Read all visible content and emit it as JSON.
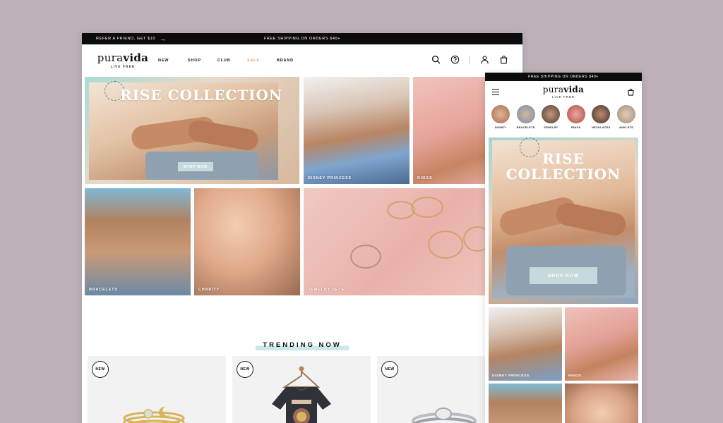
{
  "desktop": {
    "topbar": {
      "refer": "REFER A FRIEND, GET $10",
      "shipping": "FREE SHIPPING ON ORDERS $40+"
    },
    "logo": {
      "word_a": "pura",
      "word_b": "vida",
      "tagline": "LIVE FREE"
    },
    "menu": [
      "NEW",
      "SHOP",
      "CLUB",
      "SALE",
      "BRAND"
    ],
    "hero": {
      "title": "RISE COLLECTION",
      "cta": "SHOP NOW"
    },
    "tiles": {
      "disney": "DISNEY PRINCESS",
      "rings": "RINGS",
      "bracelets": "BRACELETS",
      "charity": "CHARITY",
      "sets": "JEWELRY SETS"
    },
    "trending": {
      "title": "TRENDING NOW",
      "badge": "NEW"
    }
  },
  "mobile": {
    "topbar": "FREE SHIPPING ON ORDERS $40+",
    "categories": [
      "DISNEY",
      "BRACELETS",
      "JEWELRY",
      "RINGS",
      "NECKLACES",
      "ANKLETS"
    ],
    "hero": {
      "line1": "RISE",
      "line2": "COLLECTION",
      "cta": "SHOP NOW"
    },
    "tiles": {
      "disney": "DISNEY PRINCESS",
      "rings": "RINGS"
    }
  },
  "colors": {
    "sale": "#e8a66e",
    "accent": "#cbe9ec",
    "background": "#bdb0b8"
  }
}
